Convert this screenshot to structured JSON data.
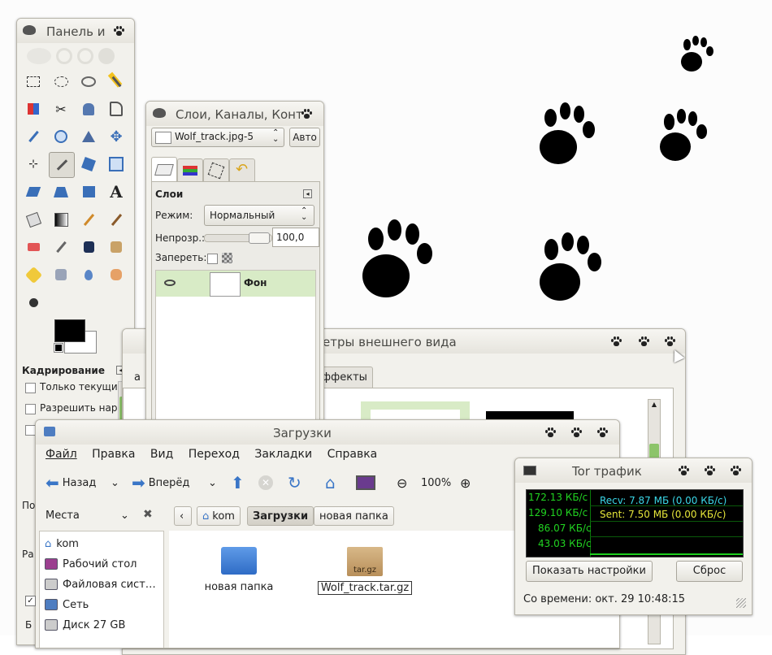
{
  "gimp_toolbox": {
    "title": "Панель и",
    "tool_options": {
      "header": "Кадрирование",
      "opt1": "Только текущий",
      "opt2": "Разрешить нара"
    }
  },
  "layers_dialog": {
    "title": "Слои, Каналы, Конт",
    "image_select": "Wolf_track.jpg-5",
    "auto_button": "Авто",
    "section": "Слои",
    "mode_label": "Режим:",
    "mode_value": "Нормальный",
    "opacity_label": "Непрозр.:",
    "opacity_value": "100,0",
    "lock_label": "Запереть:",
    "layer_name": "Фон"
  },
  "appearance_dialog": {
    "title": "етры внешнего вида",
    "tab_left": "а",
    "tab_effects": "ффекты"
  },
  "file_manager": {
    "title": "Загрузки",
    "menu": [
      "Файл",
      "Правка",
      "Вид",
      "Переход",
      "Закладки",
      "Справка"
    ],
    "toolbar": {
      "back": "Назад",
      "forward": "Вперёд",
      "zoom": "100%"
    },
    "places_label": "Места",
    "crumbs": [
      "kom",
      "Загрузки",
      "новая папка"
    ],
    "places": [
      "kom",
      "Рабочий стол",
      "Файловая сист…",
      "Сеть",
      "Диск 27 GB"
    ],
    "files": [
      {
        "name": "новая папка"
      },
      {
        "name": "Wolf_track.tar.gz",
        "ext_label": "tar.gz"
      }
    ],
    "left_fragments": [
      "По",
      "Ра",
      "Б"
    ]
  },
  "tor_traffic": {
    "title": "Tor трафик",
    "axis_labels": [
      "172.13 КБ/с",
      "129.10 КБ/с",
      "86.07 КБ/с",
      "43.03 КБ/с"
    ],
    "recv": "Recv: 7.87 МБ (0.00 КБ/с)",
    "sent": "Sent: 7.50 МБ (0.00 КБ/с)",
    "settings_button": "Показать настройки",
    "reset_button": "Сброс",
    "since": "Со времени: окт. 29 10:48:15"
  }
}
